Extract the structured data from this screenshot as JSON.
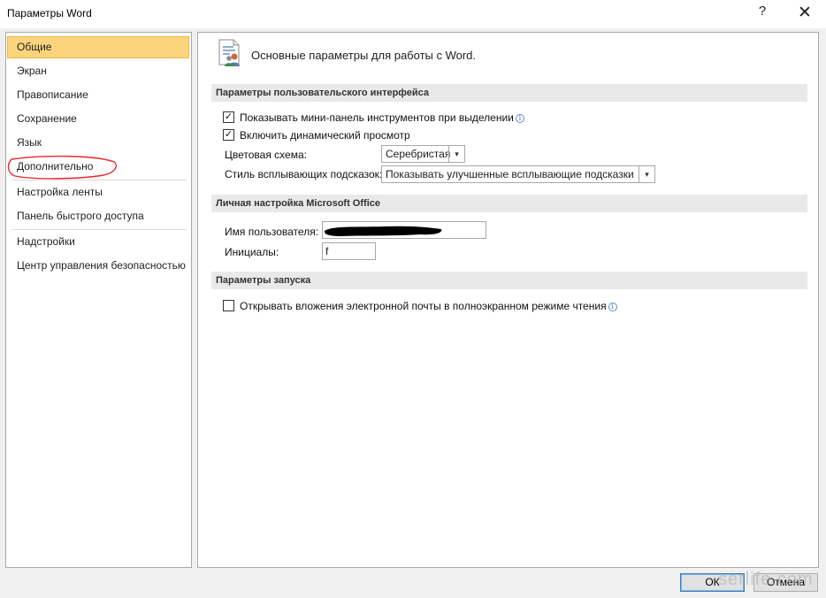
{
  "window": {
    "title": "Параметры Word",
    "help_glyph": "?",
    "close_glyph": "✕"
  },
  "nav": {
    "items": [
      {
        "label": "Общие",
        "selected": true
      },
      {
        "label": "Экран"
      },
      {
        "label": "Правописание"
      },
      {
        "label": "Сохранение"
      },
      {
        "label": "Язык"
      },
      {
        "label": "Дополнительно"
      },
      {
        "label": "Настройка ленты"
      },
      {
        "label": "Панель быстрого доступа"
      },
      {
        "label": "Надстройки"
      },
      {
        "label": "Центр управления безопасностью"
      }
    ],
    "annotation_color": "#e8262a"
  },
  "main": {
    "header": "Основные параметры для работы с Word.",
    "sections": {
      "ui": {
        "title": "Параметры пользовательского интерфейса",
        "mini_toolbar": {
          "label": "Показывать мини-панель инструментов при выделении",
          "checked": true
        },
        "live_preview": {
          "label": "Включить динамический просмотр",
          "checked": true
        },
        "color_scheme": {
          "label": "Цветовая схема:",
          "value": "Серебристая"
        },
        "tooltip_style": {
          "label": "Стиль всплывающих подсказок:",
          "value": "Показывать улучшенные всплывающие подсказки"
        }
      },
      "personal": {
        "title": "Личная настройка Microsoft Office",
        "username": {
          "label": "Имя пользователя:",
          "value": ""
        },
        "initials": {
          "label": "Инициалы:",
          "value": "f"
        }
      },
      "startup": {
        "title": "Параметры запуска",
        "open_attachments": {
          "label": "Открывать вложения электронной почты в полноэкранном режиме чтения",
          "checked": false
        }
      }
    }
  },
  "footer": {
    "ok": "ОК",
    "cancel": "Отмена",
    "watermark": "serlife.com"
  },
  "glyphs": {
    "check": "✓",
    "info": "i",
    "dropdown": "▾"
  }
}
